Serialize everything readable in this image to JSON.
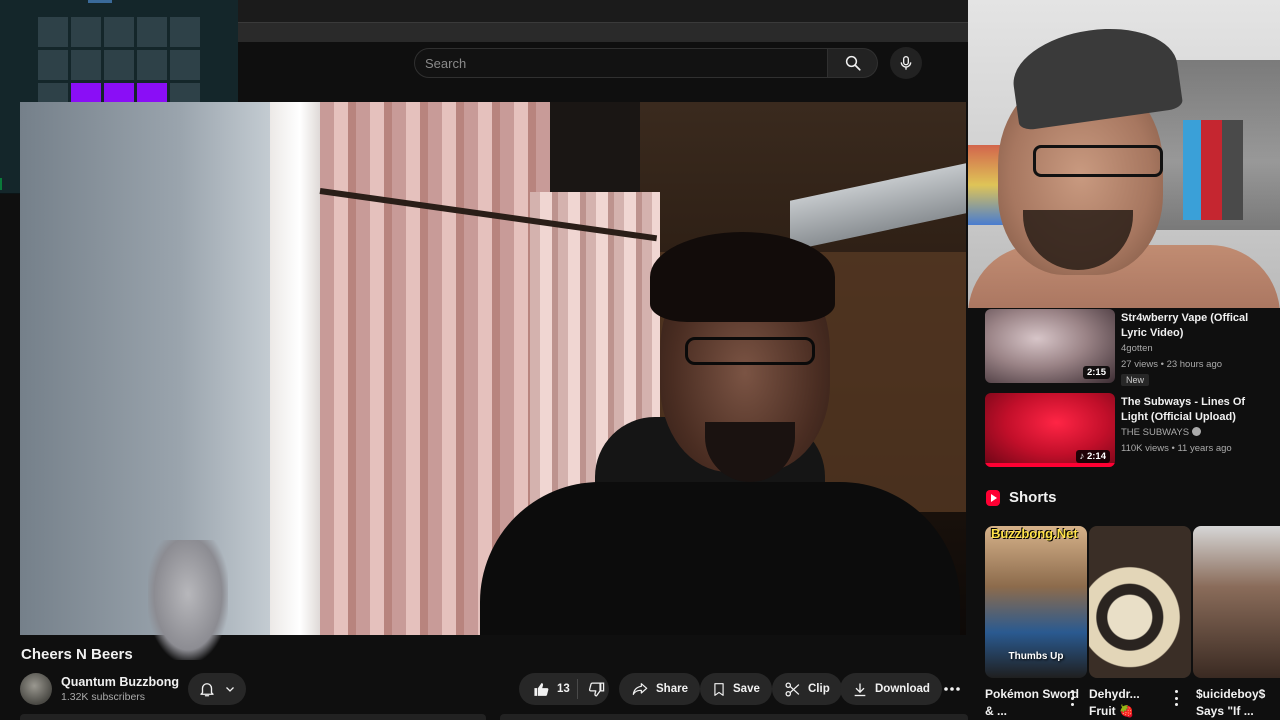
{
  "search": {
    "placeholder": "Search"
  },
  "launchpad": {
    "rows": [
      [
        false,
        false,
        false,
        false,
        false
      ],
      [
        false,
        false,
        false,
        false,
        false
      ],
      [
        false,
        true,
        true,
        true,
        false
      ],
      [
        true,
        false,
        false,
        false,
        true
      ],
      [
        false,
        false,
        false,
        false,
        false
      ]
    ],
    "active_color": "#8a0ef6"
  },
  "video": {
    "title": "Cheers N Beers",
    "channel": "Quantum Buzzbong",
    "subscribers": "1.32K subscribers",
    "likes": "13",
    "actions": {
      "share": "Share",
      "save": "Save",
      "clip": "Clip",
      "download": "Download"
    }
  },
  "recommendations": [
    {
      "title": "Str4wberry Vape (Offical Lyric Video)",
      "channel": "4gotten",
      "meta": "27 views • 23 hours ago",
      "badge": "New",
      "duration": "2:15"
    },
    {
      "title": "The Subways - Lines Of Light (Official Upload)",
      "channel": "THE SUBWAYS",
      "meta": "110K views • 11 years ago",
      "duration": "2:14"
    }
  ],
  "shorts": {
    "header": "Shorts",
    "items": [
      {
        "overlay_top": "Buzzbong.Net",
        "overlay_caption": "Thumbs Up",
        "title": "Pokémon Sword & ..."
      },
      {
        "title": "Dehydr... Fruit 🍓"
      },
      {
        "title": "$uicideboy$ Says \"If ..."
      }
    ]
  },
  "colors": {
    "accent_red": "#ff0033",
    "pad_active": "#8a0ef6",
    "pad_idle": "#2e4148"
  }
}
